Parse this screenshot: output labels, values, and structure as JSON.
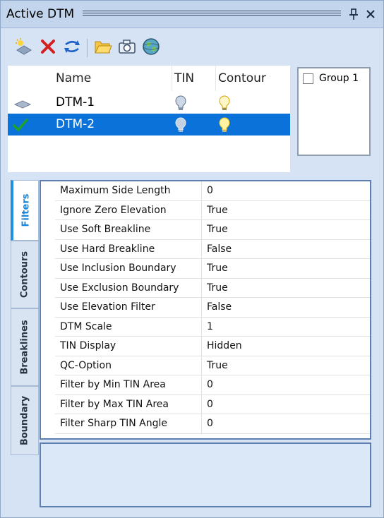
{
  "window": {
    "title": "Active DTM",
    "pin_icon": "pin-icon",
    "close_icon": "close-icon"
  },
  "toolbar": {
    "icons": [
      "new-dtm-icon",
      "delete-icon",
      "refresh-icon",
      "open-folder-icon",
      "camera-icon",
      "globe-icon"
    ]
  },
  "dtm_list": {
    "columns": {
      "name": "Name",
      "tin": "TIN",
      "contour": "Contour"
    },
    "rows": [
      {
        "name": "DTM-1",
        "selected": false,
        "active": false
      },
      {
        "name": "DTM-2",
        "selected": true,
        "active": true
      }
    ]
  },
  "groups": {
    "items": [
      {
        "label": "Group 1",
        "checked": false
      }
    ]
  },
  "tabs": [
    {
      "label": "Filters",
      "active": true
    },
    {
      "label": "Contours",
      "active": false
    },
    {
      "label": "Breaklines",
      "active": false
    },
    {
      "label": "Boundary",
      "active": false
    }
  ],
  "properties": [
    {
      "name": "Maximum Side Length",
      "value": "0"
    },
    {
      "name": "Ignore Zero Elevation",
      "value": "True"
    },
    {
      "name": "Use Soft Breakline",
      "value": "True"
    },
    {
      "name": "Use Hard Breakline",
      "value": "False"
    },
    {
      "name": "Use Inclusion Boundary",
      "value": "True"
    },
    {
      "name": "Use Exclusion Boundary",
      "value": "True"
    },
    {
      "name": "Use Elevation Filter",
      "value": "False"
    },
    {
      "name": "DTM Scale",
      "value": "1"
    },
    {
      "name": "TIN Display",
      "value": "Hidden"
    },
    {
      "name": "QC-Option",
      "value": "True"
    },
    {
      "name": "Filter by Min TIN Area",
      "value": "0"
    },
    {
      "name": "Filter by Max TIN Area",
      "value": "0"
    },
    {
      "name": "Filter Sharp TIN Angle",
      "value": "0"
    }
  ],
  "colors": {
    "panel_bg": "#d6e3f5",
    "selection": "#0a72d8",
    "tab_accent": "#1e90e0",
    "frame": "#5c7eb0"
  }
}
